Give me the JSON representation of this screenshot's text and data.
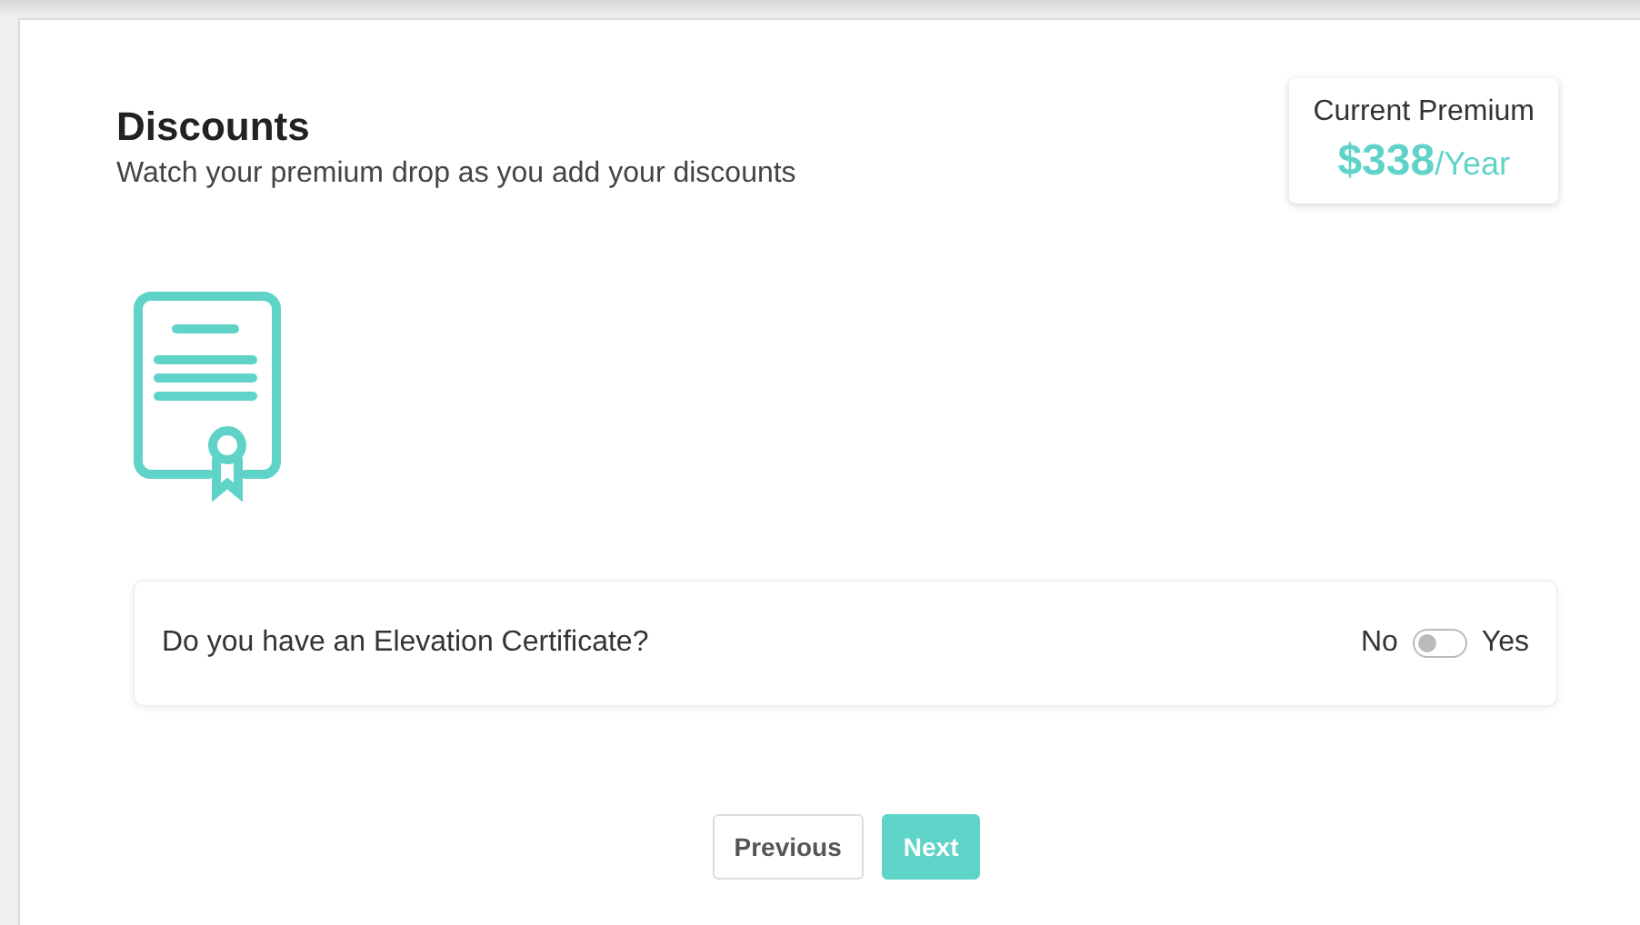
{
  "header": {
    "title": "Discounts",
    "subtitle": "Watch your premium drop as you add your discounts"
  },
  "premium": {
    "label": "Current Premium",
    "amount": "$338",
    "period": "/Year"
  },
  "question": {
    "text": "Do you have an Elevation Certificate?",
    "off_label": "No",
    "on_label": "Yes",
    "on": false
  },
  "buttons": [
    {
      "label": "Previous",
      "kind": "secondary"
    },
    {
      "label": "Next",
      "kind": "primary"
    }
  ]
}
